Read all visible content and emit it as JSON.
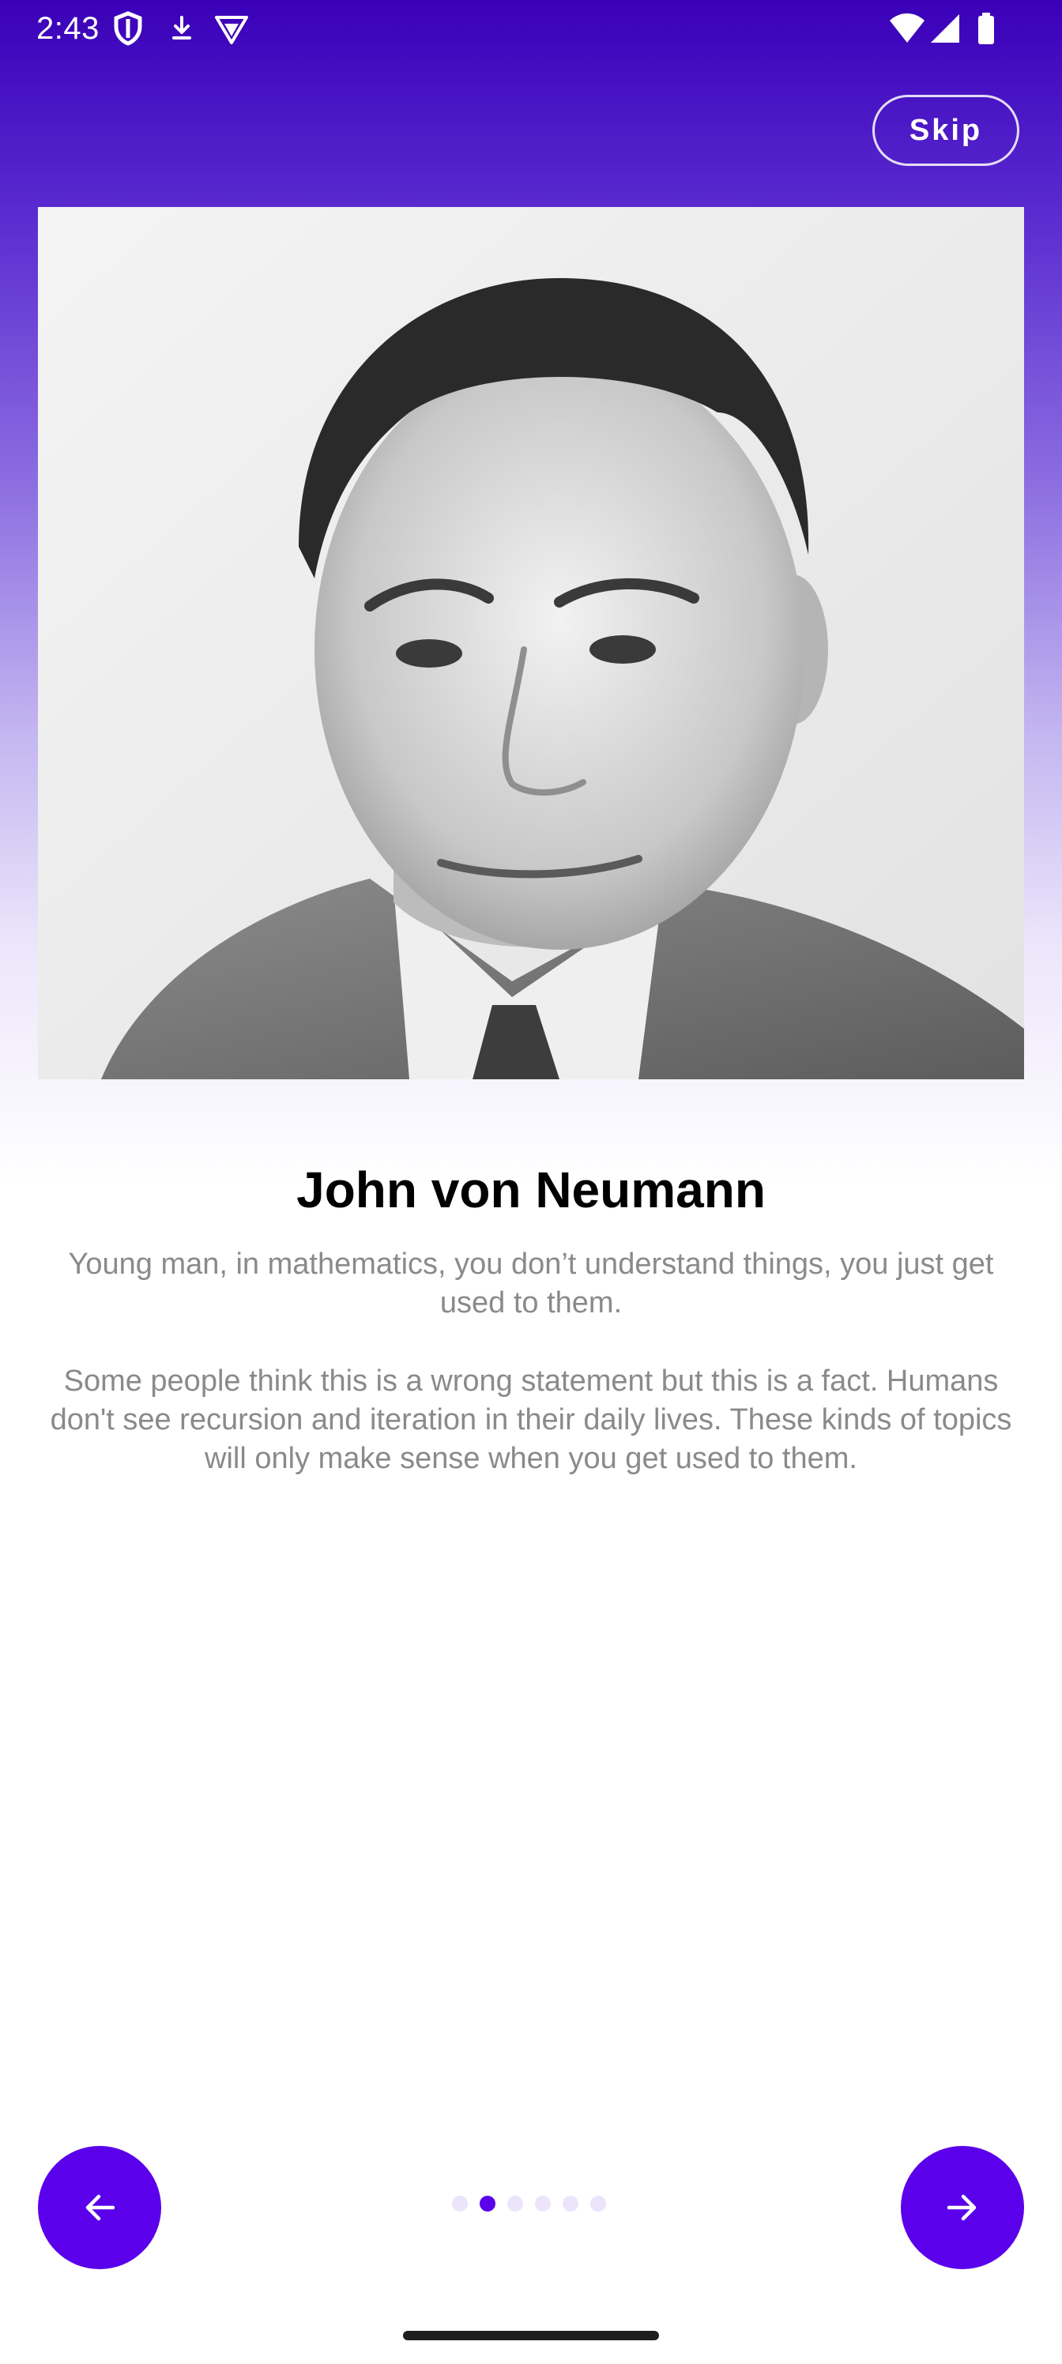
{
  "status_bar": {
    "time": "2:43",
    "icons": [
      "shield-icon",
      "download-cloud-icon",
      "vpn-shield-icon",
      "wifi-icon",
      "signal-icon",
      "battery-icon"
    ]
  },
  "header": {
    "skip_label": "Skip"
  },
  "content": {
    "portrait_icon": "portrait-photo",
    "title": "John von Neumann",
    "quote": "Young man, in mathematics, you don’t understand things, you just get used to them.",
    "description": "Some people think this is a wrong statement but this is a fact. Humans don't see recursion and iteration in their daily lives. These kinds of topics will only make sense when you get used to them."
  },
  "navigation": {
    "prev_icon": "arrow-left-icon",
    "next_icon": "arrow-right-icon",
    "page_count": 6,
    "active_page": 2
  },
  "colors": {
    "accent": "#5a00ea",
    "gradient_top": "#3a00b8",
    "text_secondary": "#8a8a8a"
  }
}
